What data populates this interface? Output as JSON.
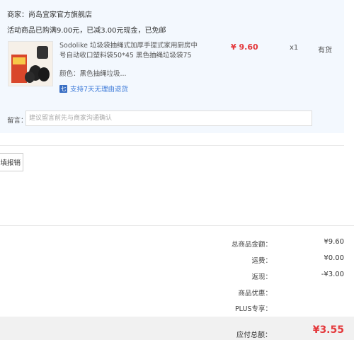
{
  "shop": {
    "seller": "商家：尚岛宜家官方旗舰店",
    "promo": "活动商品已购满9.00元，已减3.00元现金，已免邮",
    "product": {
      "title": "Sodolike 垃圾袋抽绳式加厚手提式家用厨房中号自动收口塑料袋50*45 黑色抽绳垃圾袋75",
      "price": "¥ 9.60",
      "qty": "x1",
      "stock": "有货",
      "color": "颜色：黑色抽绳垃圾...",
      "return_icon": "七",
      "return_text": "支持7天无理由退货"
    },
    "message": {
      "label": "留言：",
      "placeholder": "建议留言前先与商家沟通确认"
    }
  },
  "report_button": "填报销",
  "summary": [
    {
      "label": "总商品金额：",
      "value": "¥9.60"
    },
    {
      "label": "运费：",
      "value": "¥0.00"
    },
    {
      "label": "返现：",
      "value": "-¥3.00"
    },
    {
      "label": "商品优惠：",
      "value": ""
    },
    {
      "label": "PLUS专享：",
      "value": ""
    }
  ],
  "total": {
    "label": "应付总额：",
    "value": "¥3.55"
  },
  "colors": {
    "price_red": "#e4393c",
    "link_blue": "#3a78d8",
    "panel_bg": "#f3f8fe"
  }
}
